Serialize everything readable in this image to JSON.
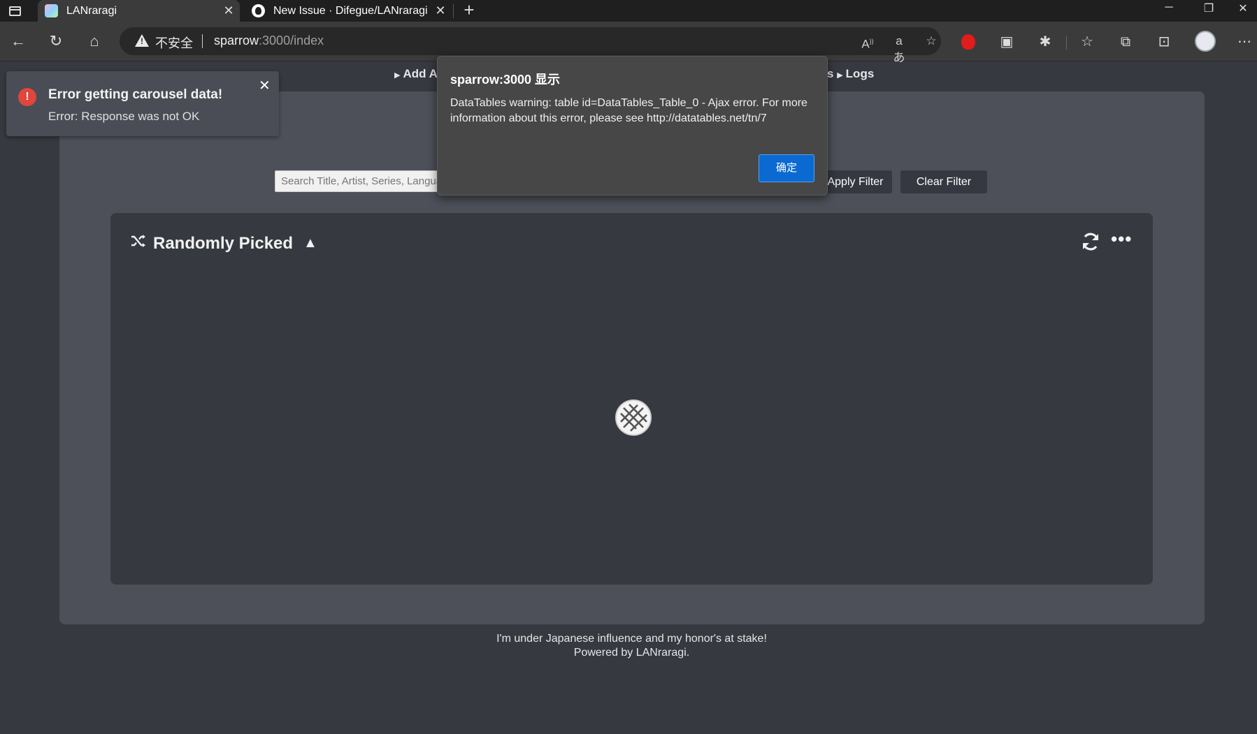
{
  "browser": {
    "tabs": [
      {
        "title": "LANraragi",
        "active": true
      },
      {
        "title": "New Issue · Difegue/LANraragi",
        "active": false
      }
    ],
    "address": {
      "security_label": "不安全",
      "host": "sparrow",
      "rest": ":3000/index"
    },
    "icons": [
      "sidebar-icon",
      "back-icon",
      "refresh-icon",
      "home-icon",
      "read-aloud-icon",
      "translate-icon",
      "add-favorite-icon",
      "extension-red-icon",
      "extension-icon",
      "puzzle-icon",
      "favorites-icon",
      "collections-icon",
      "screenshot-icon",
      "profile-icon",
      "more-icon"
    ]
  },
  "nav": {
    "add_archives": "Add Ar",
    "logs_prefix": "s",
    "logs": "Logs"
  },
  "search": {
    "placeholder": "Search Title, Artist, Series, Language",
    "apply": "Apply Filter",
    "clear": "Clear Filter"
  },
  "carousel": {
    "title": "Randomly Picked",
    "collapse_glyph": "▲",
    "more_glyph": "•••"
  },
  "footer": {
    "line1": "I'm under Japanese influence and my honor's at stake!",
    "line2": "Powered by LANraragi."
  },
  "toast": {
    "title": "Error getting carousel data!",
    "message": "Error: Response was not OK",
    "close": "✕"
  },
  "dialog": {
    "title": "sparrow:3000 显示",
    "message": "DataTables warning: table id=DataTables_Table_0 - Ajax error. For more information about this error, please see http://datatables.net/tn/7",
    "ok": "确定"
  },
  "colors": {
    "page_bg": "#363940",
    "panel_bg": "#4d5059",
    "accent_blue": "#0a6ad1",
    "error_red": "#e0463c"
  }
}
